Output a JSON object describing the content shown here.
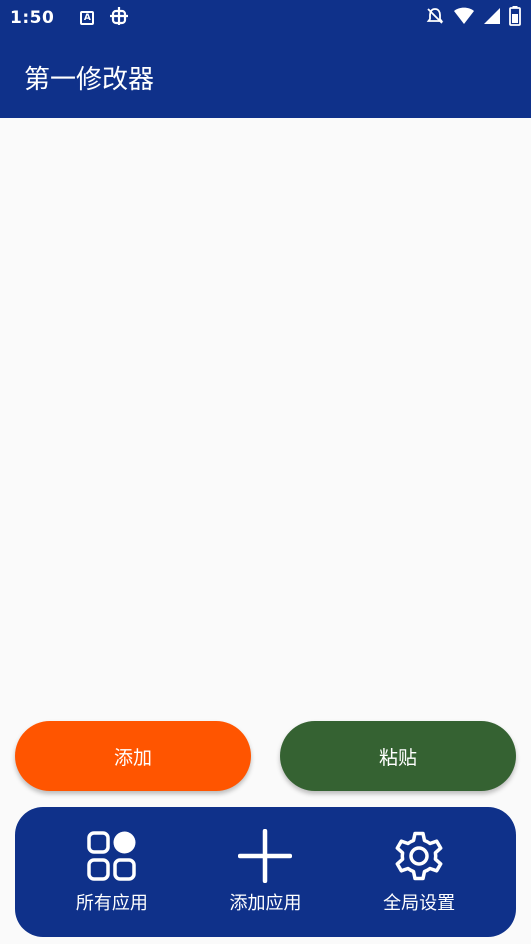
{
  "status_bar": {
    "time": "1:50",
    "icons": [
      "text-a-icon",
      "bug-icon",
      "bell-off-icon",
      "wifi-icon",
      "cell-signal-icon",
      "battery-icon"
    ]
  },
  "app_bar": {
    "title": "第一修改器"
  },
  "actions": {
    "add_label": "添加",
    "paste_label": "粘贴"
  },
  "bottom_nav": {
    "items": [
      {
        "label": "所有应用",
        "icon": "apps-grid-icon"
      },
      {
        "label": "添加应用",
        "icon": "plus-icon"
      },
      {
        "label": "全局设置",
        "icon": "gear-icon"
      }
    ]
  },
  "colors": {
    "primary": "#0f318a",
    "add_button": "#ff5500",
    "paste_button": "#356232",
    "background": "#fafafa"
  }
}
